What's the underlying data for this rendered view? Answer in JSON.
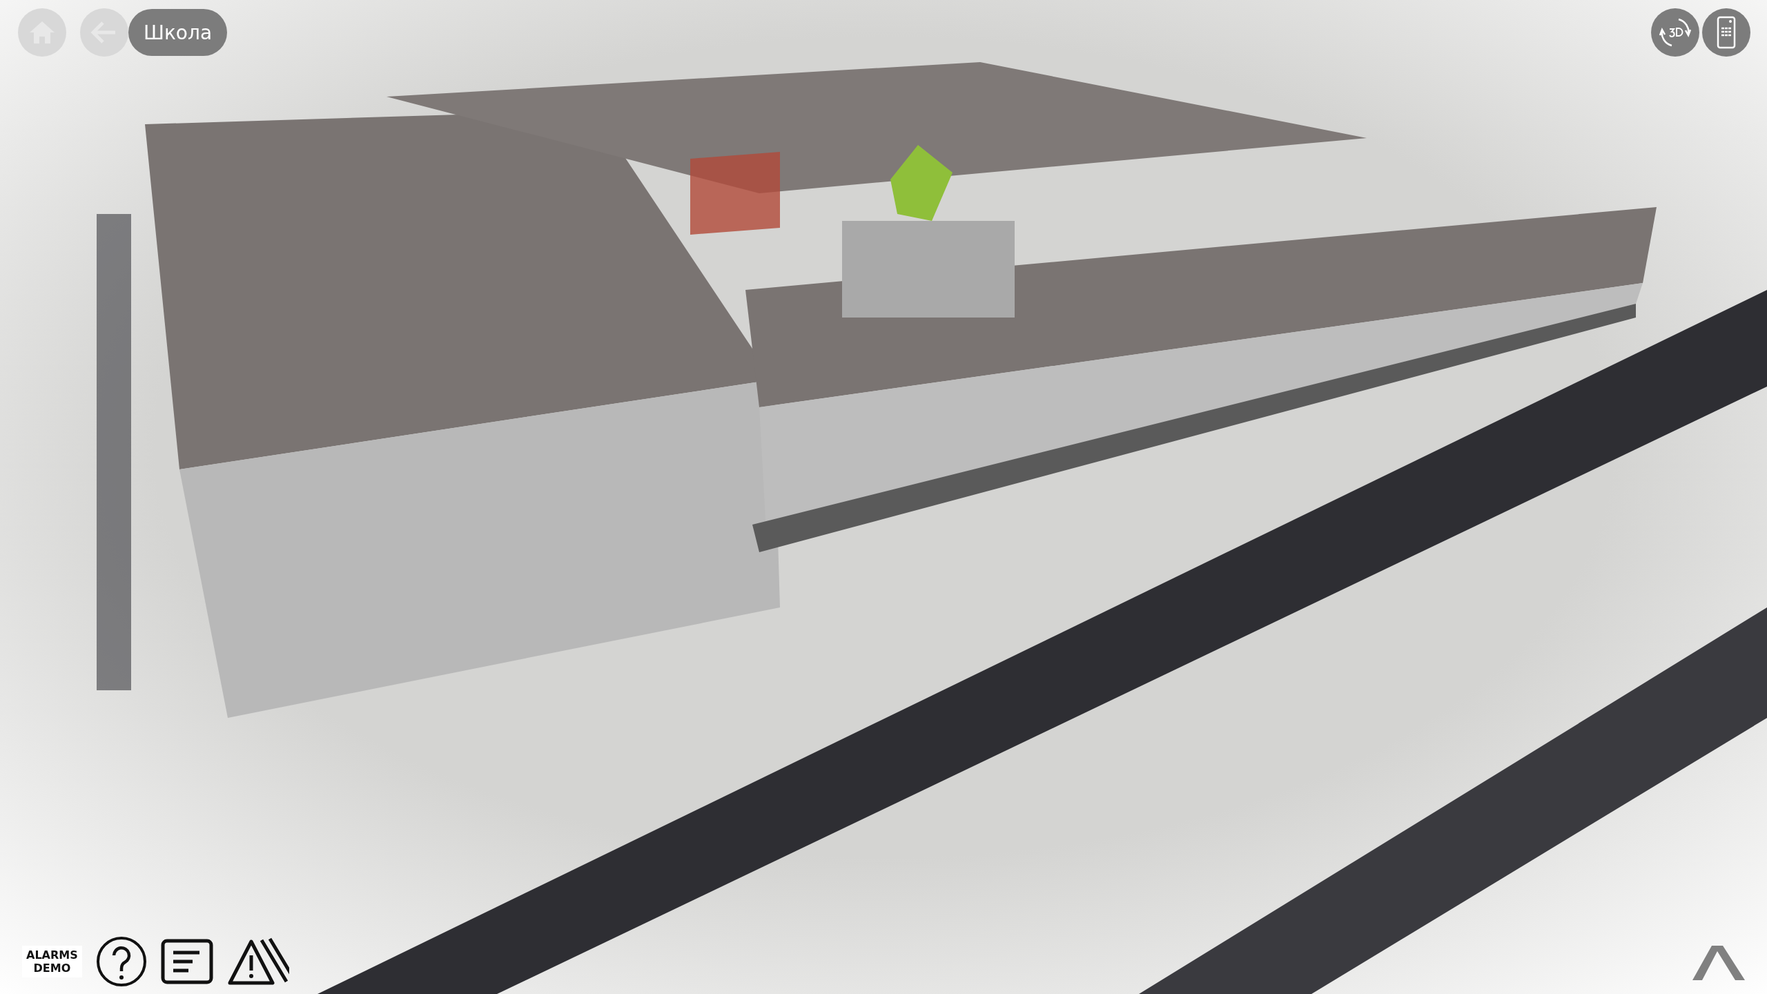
{
  "nav": {
    "home": {
      "disabled": true
    },
    "back": {
      "disabled": true
    },
    "breadcrumb": "Школа"
  },
  "brand": [
    "ALARMS",
    "DEMO"
  ]
}
